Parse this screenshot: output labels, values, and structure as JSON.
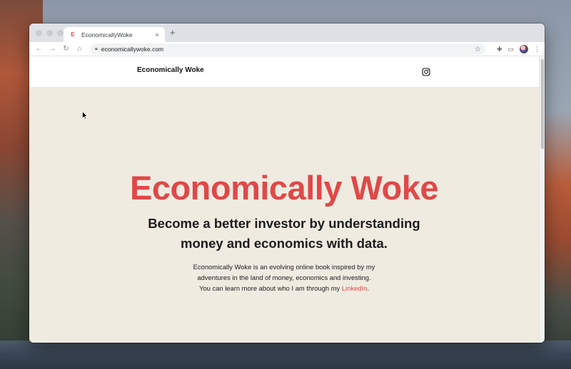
{
  "browser": {
    "tab_title": "EconomicallyWoke",
    "favicon_letter": "E",
    "tab_close": "×",
    "new_tab": "+",
    "url": "economicallywoke.com"
  },
  "site": {
    "logo_text": "Economically Woke",
    "hero_title": "Economically Woke",
    "hero_subtitle": "Become a better investor by understanding money and economics with data.",
    "hero_desc_line1": "Economically Woke is an evolving online book inspired by my",
    "hero_desc_line2": "adventures in the land of money, economics and investing.",
    "hero_desc_line3_prefix": "You can learn more about who I am through my ",
    "hero_desc_link": "LinkedIn",
    "hero_desc_line3_suffix": ".",
    "accent_color": "#e04848",
    "background_color": "#efebe1"
  },
  "icons": {
    "back": "back-arrow-icon",
    "forward": "forward-arrow-icon",
    "reload": "reload-icon",
    "home": "home-icon",
    "lock": "lock-icon",
    "star": "star-icon",
    "extensions": "puzzle-icon",
    "cast": "cast-icon",
    "menu": "kebab-menu-icon",
    "instagram": "instagram-icon"
  }
}
